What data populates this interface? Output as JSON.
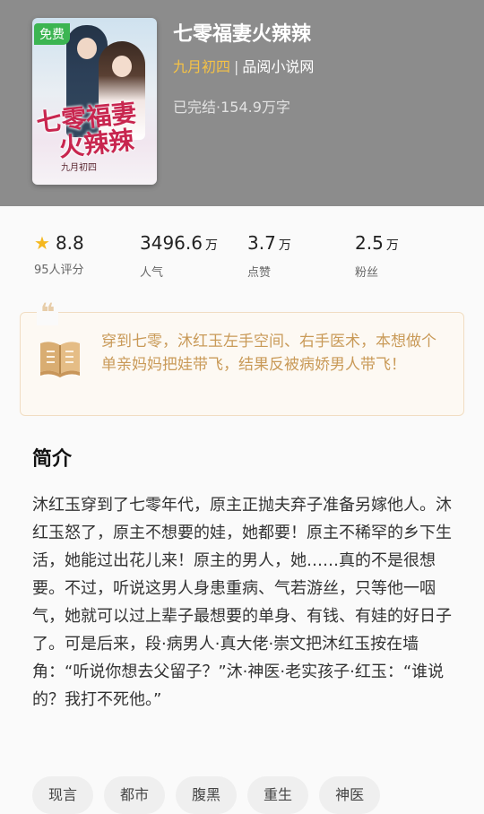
{
  "book": {
    "badge": "免费",
    "cover_title_line1": "七零福妻",
    "cover_title_line2": "火辣辣",
    "cover_author": "九月初四",
    "title": "七零福妻火辣辣",
    "author": "九月初四",
    "separator": "|",
    "publisher": "品阅小说网",
    "meta": "已完结·154.9万字"
  },
  "stats": {
    "rating": {
      "value": "8.8",
      "label": "95人评分"
    },
    "popularity": {
      "value": "3496.6",
      "unit": "万",
      "label": "人气"
    },
    "likes": {
      "value": "3.7",
      "unit": "万",
      "label": "点赞"
    },
    "fans": {
      "value": "2.5",
      "unit": "万",
      "label": "粉丝"
    }
  },
  "quote": {
    "mark": "❝",
    "text": "穿到七零，沐红玉左手空间、右手医术，本想做个单亲妈妈把娃带飞，结果反被病娇男人带飞！"
  },
  "intro": {
    "heading": "简介",
    "text": "沐红玉穿到了七零年代，原主正抛夫弃子准备另嫁他人。沐红玉怒了，原主不想要的娃，她都要！原主不稀罕的乡下生活，她能过出花儿来！原主的男人，她……真的不是很想要。不过，听说这男人身患重病、气若游丝，只等他一咽气，她就可以过上辈子最想要的单身、有钱、有娃的好日子了。可是后来，段·病男人·真大佬·崇文把沐红玉按在墙角：“听说你想去父留子？”沐·神医·老实孩子·红玉：“谁说的？我打不死他。”"
  },
  "tags": [
    "现言",
    "都市",
    "腹黑",
    "重生",
    "神医"
  ],
  "colors": {
    "header_bg": "#8c8c8c",
    "badge_bg": "#3cb552",
    "author_accent": "#f5c245",
    "star": "#f5b81f",
    "quote_text": "#c99a58"
  },
  "icons": {
    "rating": "star-icon",
    "quote": "quote-icon",
    "summary": "open-book-icon"
  }
}
